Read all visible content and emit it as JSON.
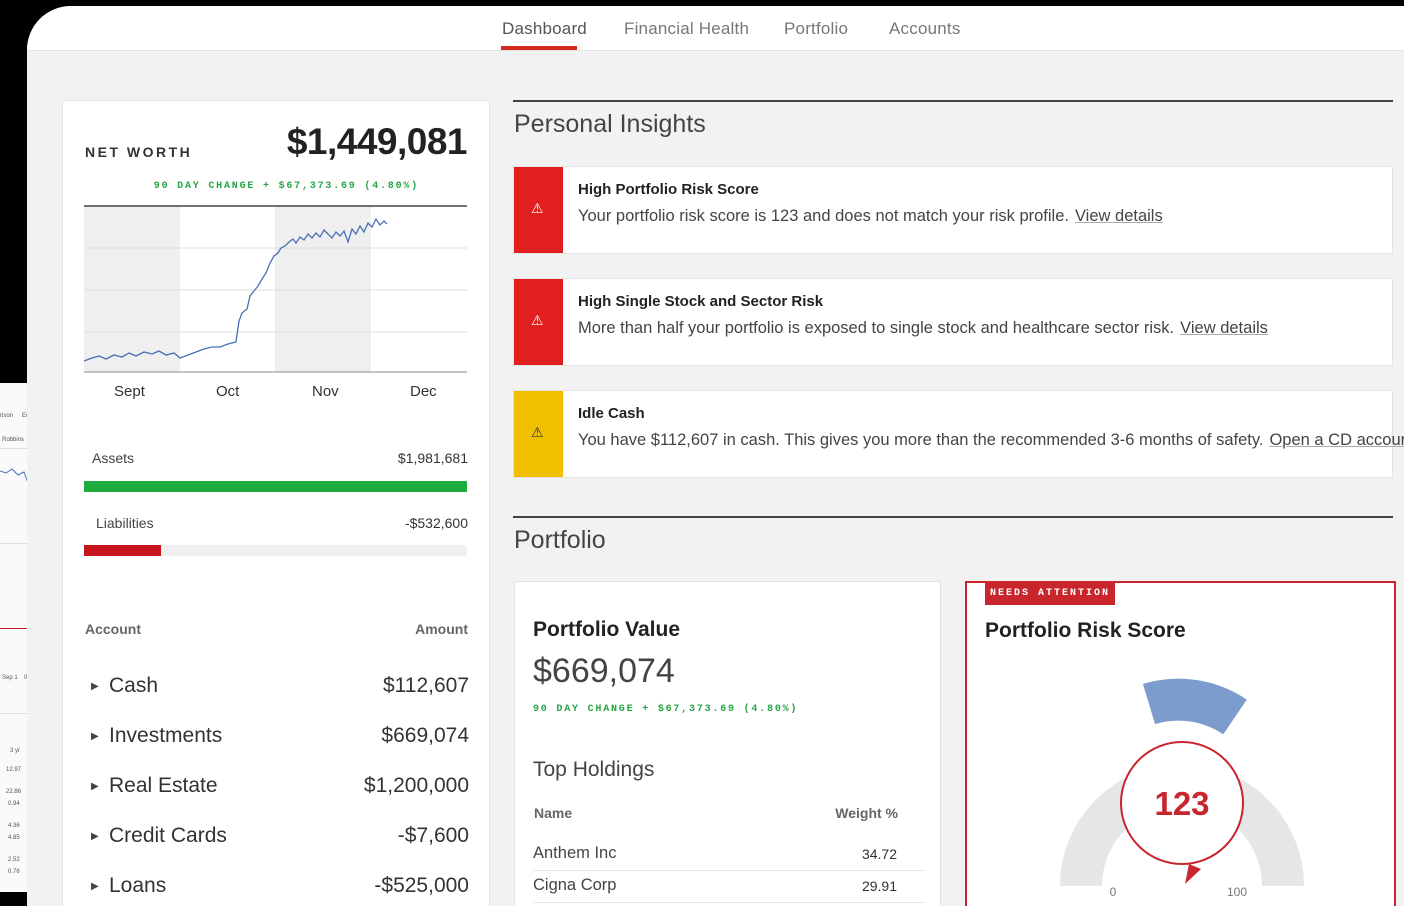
{
  "tabs": [
    {
      "label": "Dashboard",
      "active": true
    },
    {
      "label": "Financial Health",
      "active": false
    },
    {
      "label": "Portfolio",
      "active": false
    },
    {
      "label": "Accounts",
      "active": false
    }
  ],
  "net_worth": {
    "label": "NET WORTH",
    "value": "$1,449,081",
    "change": "90 DAY CHANGE + $67,373.69  (4.80%)",
    "months": [
      "Sept",
      "Oct",
      "Nov",
      "Dec"
    ],
    "assets": {
      "label": "Assets",
      "value": "$1,981,681",
      "fill": 1.0
    },
    "liabilities": {
      "label": "Liabilities",
      "value": "-$532,600",
      "fill": 0.2
    },
    "table_headers": {
      "account": "Account",
      "amount": "Amount"
    },
    "accounts": [
      {
        "name": "Cash",
        "amount": "$112,607"
      },
      {
        "name": "Investments",
        "amount": "$669,074"
      },
      {
        "name": "Real Estate",
        "amount": "$1,200,000"
      },
      {
        "name": "Credit Cards",
        "amount": "-$7,600"
      },
      {
        "name": "Loans",
        "amount": "-$525,000"
      }
    ]
  },
  "insights": {
    "title": "Personal Insights",
    "items": [
      {
        "title": "High Portfolio Risk Score",
        "body": "Your portfolio risk score is 123 and does not match your risk profile.",
        "link": "View details",
        "color": "#e21f1f"
      },
      {
        "title": "High Single Stock and Sector Risk",
        "body": "More than half your portfolio is exposed to single stock and healthcare sector risk.",
        "link": "View details",
        "color": "#e21f1f"
      },
      {
        "title": "Idle Cash",
        "body": "You have $112,607 in cash. This gives you more than the recommended 3-6 months of safety.",
        "link": "Open a CD account",
        "color": "#f0c000"
      }
    ]
  },
  "portfolio": {
    "title": "Portfolio",
    "value_card": {
      "title": "Portfolio Value",
      "value": "$669,074",
      "change": "90 DAY CHANGE + $67,373.69  (4.80%)",
      "holdings_title": "Top Holdings",
      "headers": {
        "name": "Name",
        "weight": "Weight %"
      },
      "holdings": [
        {
          "name": "Anthem Inc",
          "weight": "34.72"
        },
        {
          "name": "Cigna Corp",
          "weight": "29.91"
        }
      ]
    },
    "risk_card": {
      "badge": "NEEDS ATTENTION",
      "title": "Portfolio Risk Score",
      "score": "123",
      "min": "0",
      "max": "100"
    }
  },
  "background_window": {
    "labels": [
      "rison",
      "Eq",
      "Robbins",
      "Sep 1",
      "0",
      "3 yr",
      "12.97",
      "22.86",
      "0.94",
      "4.36",
      "4.85",
      "2.52",
      "0.76"
    ]
  },
  "colors": {
    "accent": "#d52b1e",
    "positive": "#27a444",
    "assets_bar": "#1eac3e",
    "liabilities_bar": "#c8141c",
    "warning": "#f0c000"
  }
}
